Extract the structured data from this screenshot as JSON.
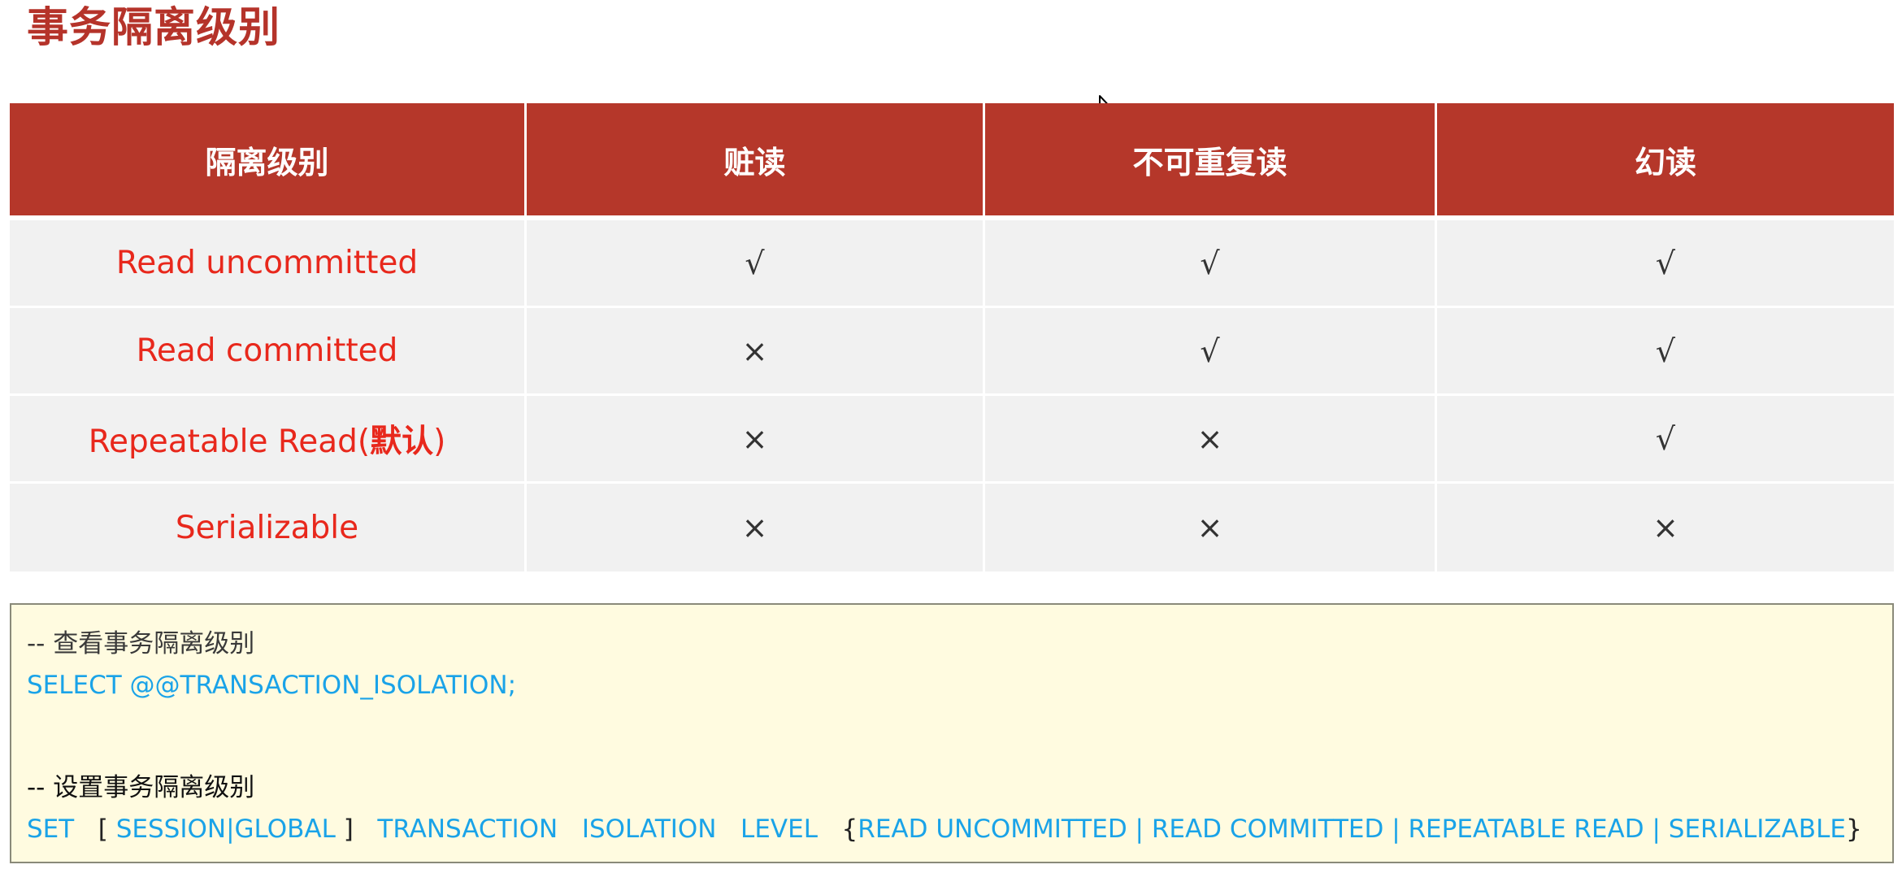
{
  "title": "事务隔离级别",
  "table": {
    "headers": [
      "隔离级别",
      "赃读",
      "不可重复读",
      "幻读"
    ],
    "rows": [
      {
        "level": "Read uncommitted",
        "level_suffix": "",
        "dirty": "√",
        "nonrepeatable": "√",
        "phantom": "√"
      },
      {
        "level": "Read committed",
        "level_suffix": "",
        "dirty": "×",
        "nonrepeatable": "√",
        "phantom": "√"
      },
      {
        "level": "Repeatable Read(",
        "level_suffix": "默认",
        "level_close": ")",
        "dirty": "×",
        "nonrepeatable": "×",
        "phantom": "√"
      },
      {
        "level": "Serializable",
        "level_suffix": "",
        "dirty": "×",
        "nonrepeatable": "×",
        "phantom": "×"
      }
    ]
  },
  "code": {
    "comment_view": "-- 查看事务隔离级别",
    "select_stmt": "SELECT @@TRANSACTION_ISOLATION;",
    "comment_set": "-- 设置事务隔离级别",
    "set_stmt": {
      "set": "SET",
      "open_bracket": "[",
      "scope": "SESSION|GLOBAL",
      "close_bracket": "]",
      "transaction": "TRANSACTION",
      "isolation": "ISOLATION",
      "level": "LEVEL",
      "open_brace": "{",
      "options": "READ UNCOMMITTED | READ COMMITTED | REPEATABLE READ | SERIALIZABLE",
      "close_brace": "}"
    }
  },
  "colors": {
    "header_bg": "#b5372a",
    "title": "#b5332a",
    "level_text": "#e8281c",
    "code_bg": "#fffbe0",
    "code_keyword": "#1aa3e8"
  }
}
